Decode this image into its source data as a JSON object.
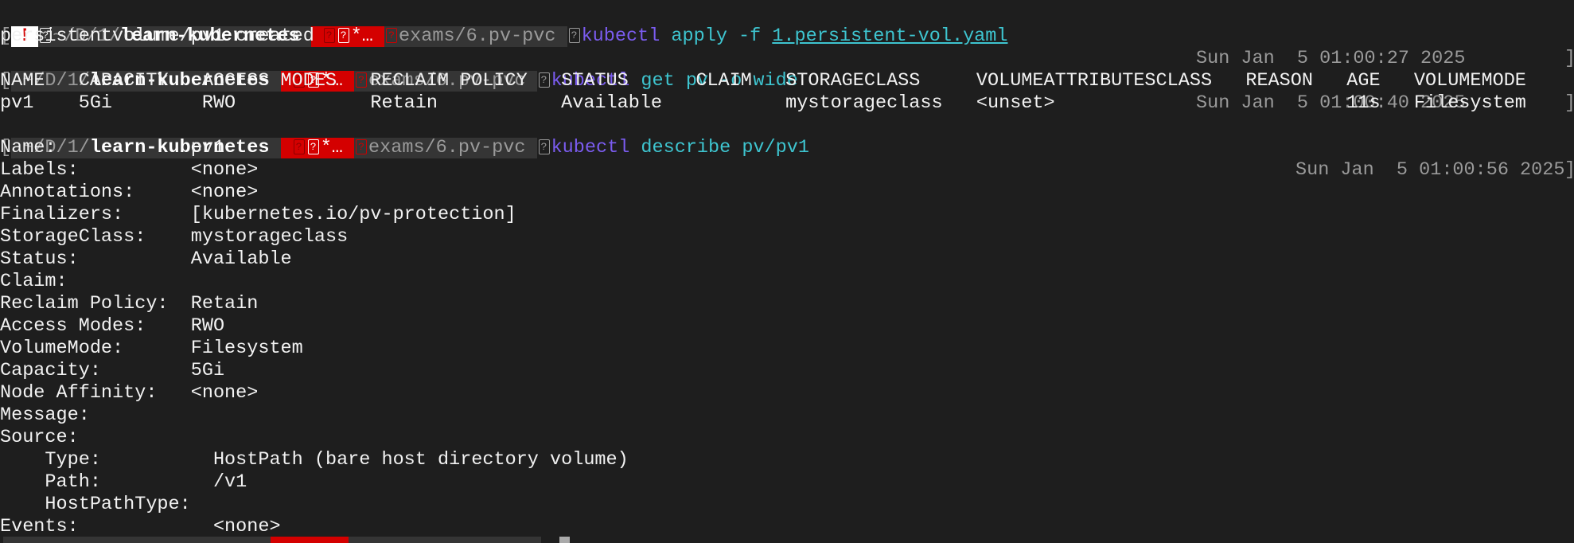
{
  "prompts": [
    {
      "bracket": "[",
      "warning": "!",
      "path_prefix": "~/D/1/",
      "path_dir": "learn-kubernetes",
      "status": "*…",
      "branch": "exams/6.pv-pvc",
      "cmd": "kubectl",
      "args": "apply -f ",
      "file": "1.persistent-vol.yaml",
      "time": "Sun Jan  5 01:00:27 2025",
      "end": "]"
    },
    {
      "bracket": "[",
      "path_prefix": "~/D/1/",
      "path_dir": "learn-kubernetes",
      "status": "*…",
      "branch": "exams/6.pv-pvc",
      "cmd": "kubectl",
      "args": "get pv -o wide",
      "time": "Sun Jan  5 01:00:40 2025",
      "end": "]"
    },
    {
      "bracket": "[",
      "path_prefix": "~/D/1/",
      "path_dir": "learn-kubernetes",
      "status": "*…",
      "branch": "exams/6.pv-pvc",
      "cmd": "kubectl",
      "args": "describe pv/pv1",
      "time": "Sun Jan  5 01:00:56 2025",
      "end": "]"
    }
  ],
  "output_apply": "persistentvolume/pv1 created",
  "table": {
    "header": "NAME   CAPACITY   ACCESS MODES   RECLAIM POLICY   STATUS      CLAIM   STORAGECLASS     VOLUMEATTRIBUTESCLASS   REASON   AGE   VOLUMEMODE",
    "rows": [
      "pv1    5Gi        RWO            Retain           Available           mystorageclass   <unset>                          11s   Filesystem"
    ]
  },
  "describe": [
    "Name:            pv1",
    "Labels:          <none>",
    "Annotations:     <none>",
    "Finalizers:      [kubernetes.io/pv-protection]",
    "StorageClass:    mystorageclass",
    "Status:          Available",
    "Claim:",
    "Reclaim Policy:  Retain",
    "Access Modes:    RWO",
    "VolumeMode:      Filesystem",
    "Capacity:        5Gi",
    "Node Affinity:   <none>",
    "Message:",
    "Source:",
    "    Type:          HostPath (bare host directory volume)",
    "    Path:          /v1",
    "    HostPathType:",
    "Events:            <none>"
  ]
}
